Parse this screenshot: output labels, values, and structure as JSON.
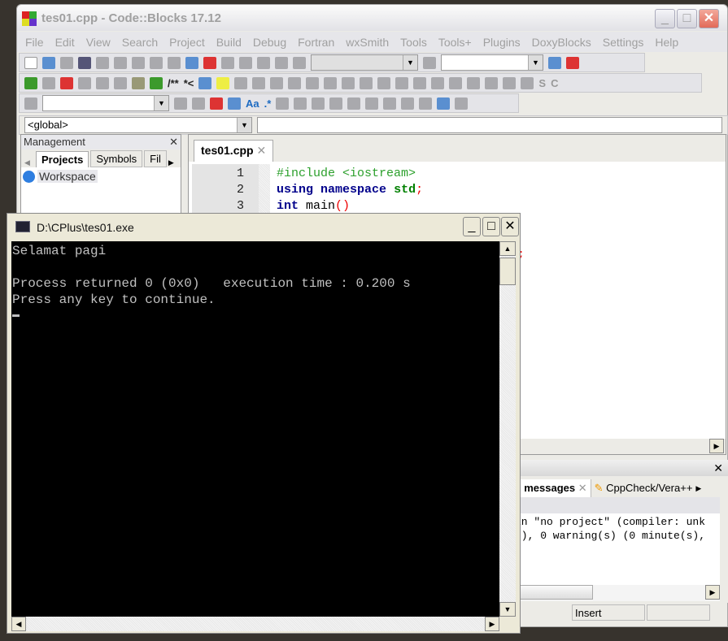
{
  "ide": {
    "title": "tes01.cpp - Code::Blocks 17.12",
    "menu": [
      "File",
      "Edit",
      "View",
      "Search",
      "Project",
      "Build",
      "Debug",
      "Fortran",
      "wxSmith",
      "Tools",
      "Tools+",
      "Plugins",
      "DoxyBlocks",
      "Settings",
      "Help"
    ],
    "toolbar_text": {
      "doxy_comment": "/**",
      "doxy_line": "*<",
      "bold_s": "S",
      "bold_c": "C",
      "regex": ".*",
      "case": "Aa"
    },
    "scope_combo": "<global>",
    "management": {
      "title": "Management",
      "close": "✕",
      "tabs": [
        "Projects",
        "Symbols",
        "Fil"
      ],
      "tree_root": "Workspace"
    },
    "editor": {
      "tab": "tes01.cpp",
      "tab_close": "✕",
      "line_numbers": [
        "1",
        "2",
        "3"
      ],
      "code": {
        "l1": "#include <iostream>",
        "l2_kw": "using",
        "l2_kw2": "namespace",
        "l2_std": "std",
        "l2_semi": ";",
        "l3_kw": "int",
        "l3_name": " main",
        "l3_paren": "()"
      },
      "partial_semi": ";"
    },
    "logs": {
      "close": "✕",
      "tabs": [
        "l messages",
        "CppCheck/Vera++"
      ],
      "lines": [
        "in \"no project\" (compiler: unk",
        "s), 0 warning(s) (0 minute(s),"
      ]
    },
    "status": {
      "mode": "Insert"
    }
  },
  "console": {
    "title": "D:\\CPlus\\tes01.exe",
    "output": "Selamat pagi\n\nProcess returned 0 (0x0)   execution time : 0.200 s\nPress any key to continue.\n"
  }
}
